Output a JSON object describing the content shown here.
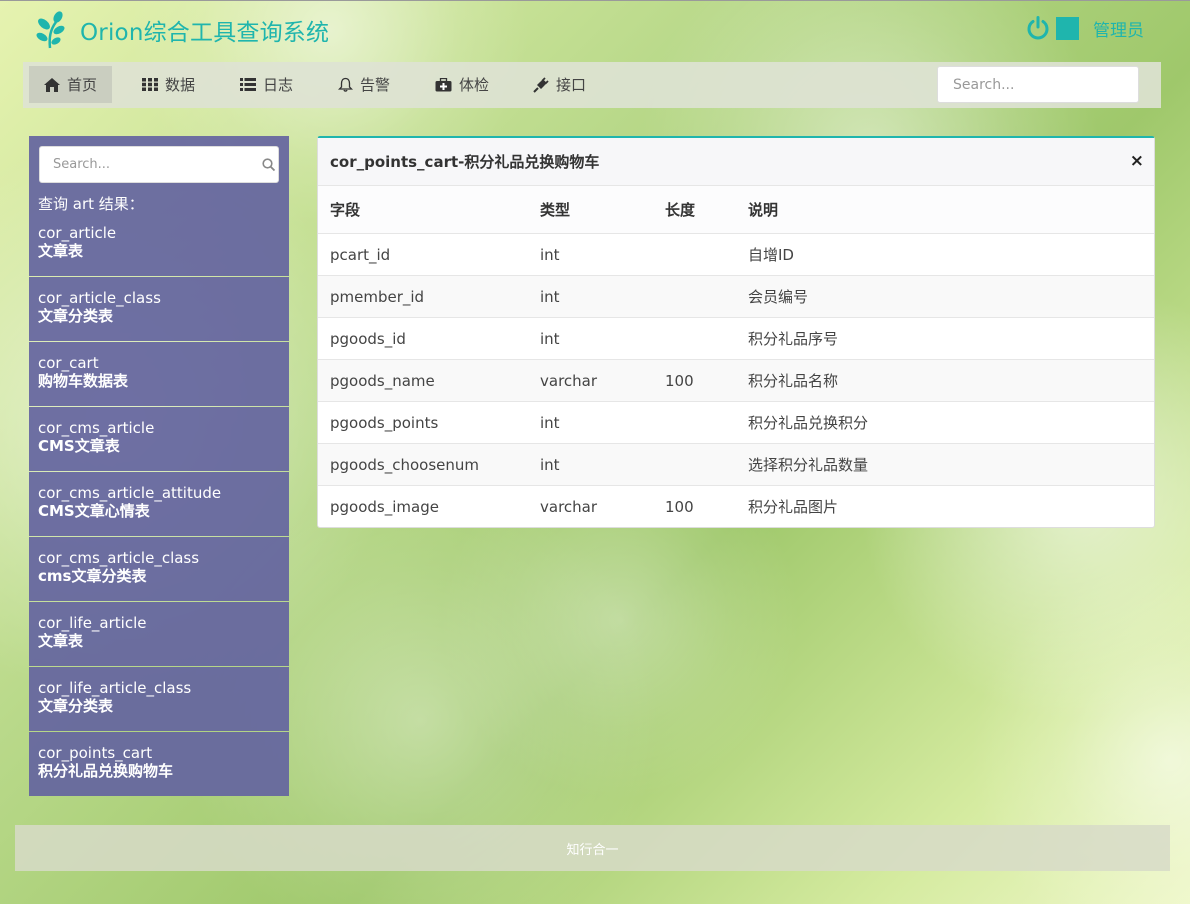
{
  "app": {
    "title": "Orion综合工具查询系统",
    "user": "管理员",
    "accent_color": "#1fb5ad"
  },
  "nav": {
    "items": [
      {
        "label": "首页",
        "icon": "home-icon",
        "active": true
      },
      {
        "label": "数据",
        "icon": "grid-icon"
      },
      {
        "label": "日志",
        "icon": "list-icon"
      },
      {
        "label": "告警",
        "icon": "bell-icon"
      },
      {
        "label": "体检",
        "icon": "medkit-icon"
      },
      {
        "label": "接口",
        "icon": "plug-icon"
      }
    ],
    "search_placeholder": "Search..."
  },
  "sidebar": {
    "search_placeholder": "Search...",
    "result_label": "查询 art 结果：",
    "items": [
      {
        "name": "cor_article",
        "desc": "文章表"
      },
      {
        "name": "cor_article_class",
        "desc": "文章分类表"
      },
      {
        "name": "cor_cart",
        "desc": "购物车数据表"
      },
      {
        "name": "cor_cms_article",
        "desc": "CMS文章表"
      },
      {
        "name": "cor_cms_article_attitude",
        "desc": "CMS文章心情表"
      },
      {
        "name": "cor_cms_article_class",
        "desc": "cms文章分类表"
      },
      {
        "name": "cor_life_article",
        "desc": "文章表"
      },
      {
        "name": "cor_life_article_class",
        "desc": "文章分类表"
      },
      {
        "name": "cor_points_cart",
        "desc": "积分礼品兑换购物车"
      }
    ]
  },
  "panel": {
    "title": "cor_points_cart-积分礼品兑换购物车",
    "close": "×",
    "columns": [
      "字段",
      "类型",
      "长度",
      "说明"
    ],
    "rows": [
      [
        "pcart_id",
        "int",
        "",
        "自增ID"
      ],
      [
        "pmember_id",
        "int",
        "",
        "会员编号"
      ],
      [
        "pgoods_id",
        "int",
        "",
        "积分礼品序号"
      ],
      [
        "pgoods_name",
        "varchar",
        "100",
        "积分礼品名称"
      ],
      [
        "pgoods_points",
        "int",
        "",
        "积分礼品兑换积分"
      ],
      [
        "pgoods_choosenum",
        "int",
        "",
        "选择积分礼品数量"
      ],
      [
        "pgoods_image",
        "varchar",
        "100",
        "积分礼品图片"
      ]
    ]
  },
  "footer": {
    "text": "知行合一"
  }
}
